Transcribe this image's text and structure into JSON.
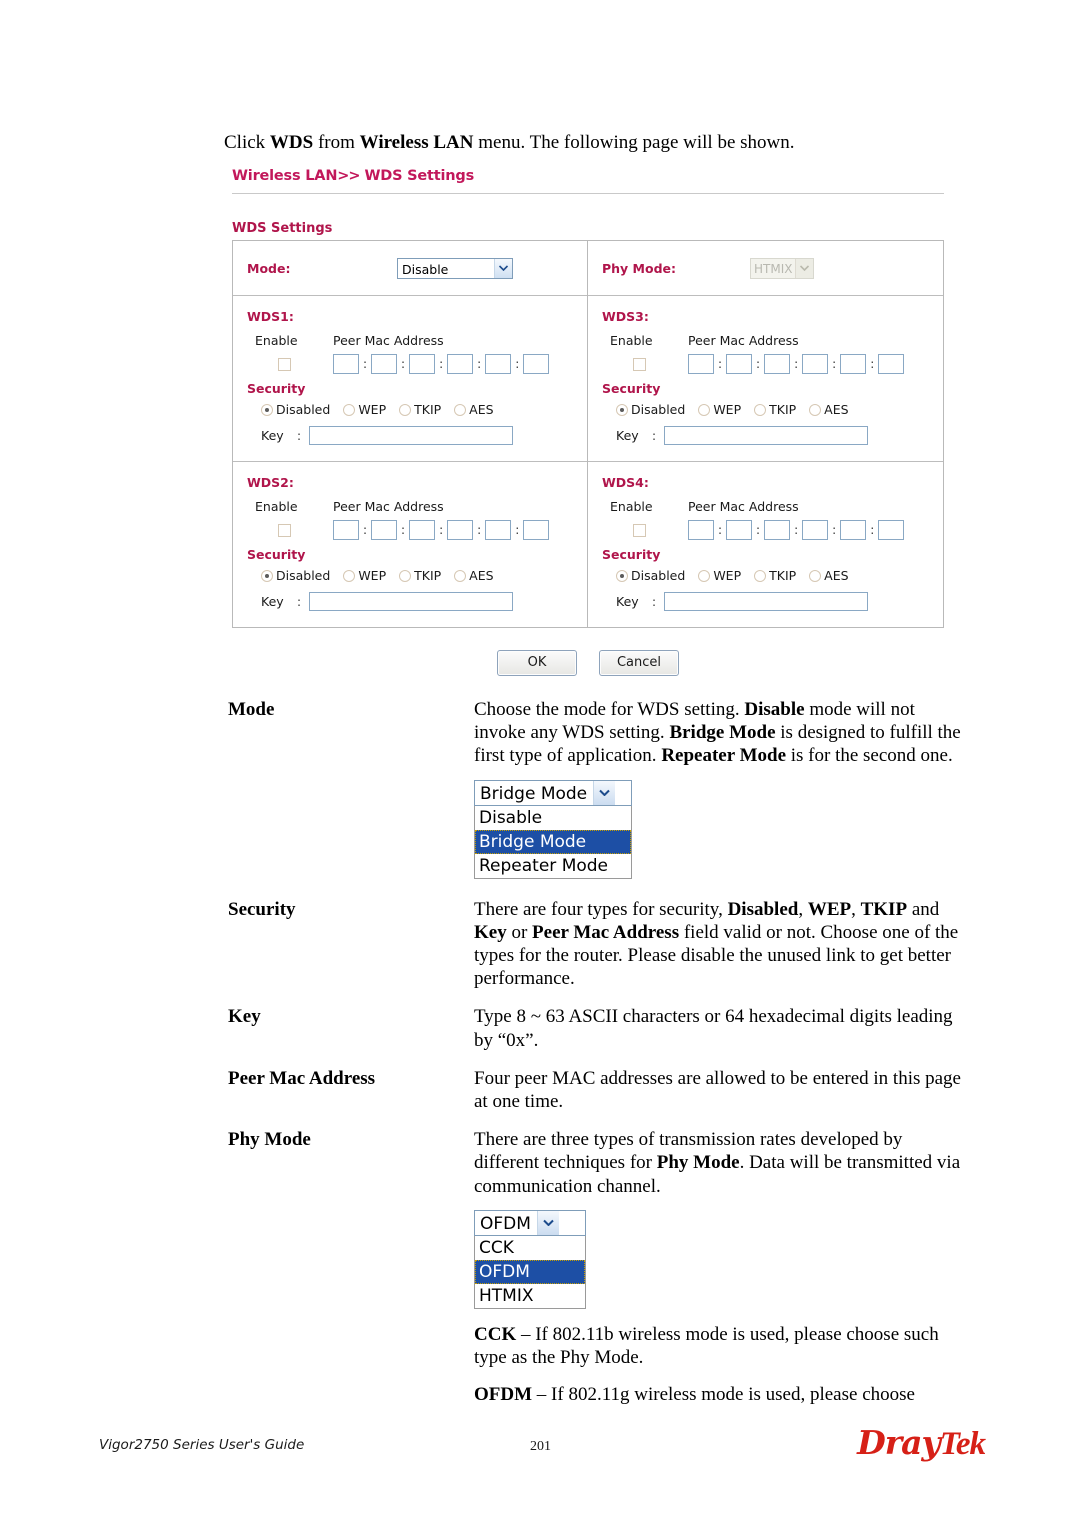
{
  "intro": {
    "pre": "Click ",
    "b1": "WDS",
    "mid1": " from ",
    "b2": "Wireless LAN",
    "post": " menu. The following page will be shown."
  },
  "router_ui": {
    "breadcrumb": {
      "part1": "Wireless LAN",
      "separator": ">>",
      "part2": "WDS Settings"
    },
    "section_title": "WDS Settings",
    "mode": {
      "label": "Mode:",
      "value": "Disable",
      "options": [
        "Disable",
        "Bridge Mode",
        "Repeater Mode"
      ]
    },
    "phy_mode": {
      "label": "Phy Mode:",
      "value": "HTMIX",
      "options": [
        "CCK",
        "OFDM",
        "HTMIX"
      ]
    },
    "column_headers": {
      "enable": "Enable",
      "peer_mac": "Peer Mac Address"
    },
    "security_label": "Security",
    "key_label": "Key",
    "colon": ":",
    "mac_separator": ":",
    "security_options": [
      "Disabled",
      "WEP",
      "TKIP",
      "AES"
    ],
    "security_selected": "Disabled",
    "wds_blocks": [
      {
        "title": "WDS1:",
        "enabled": false,
        "mac": [
          "",
          "",
          "",
          "",
          "",
          ""
        ],
        "key": ""
      },
      {
        "title": "WDS2:",
        "enabled": false,
        "mac": [
          "",
          "",
          "",
          "",
          "",
          ""
        ],
        "key": ""
      },
      {
        "title": "WDS3:",
        "enabled": false,
        "mac": [
          "",
          "",
          "",
          "",
          "",
          ""
        ],
        "key": ""
      },
      {
        "title": "WDS4:",
        "enabled": false,
        "mac": [
          "",
          "",
          "",
          "",
          "",
          ""
        ],
        "key": ""
      }
    ],
    "buttons": {
      "ok": "OK",
      "cancel": "Cancel"
    },
    "colors": {
      "heading": "#c2185b",
      "label": "#b0154b",
      "input_border": "#8aa8c4",
      "select_border": "#7f9db9"
    }
  },
  "definitions": [
    {
      "term": "Mode",
      "desc_html": "Choose the mode for WDS setting. <b>Disable</b> mode will not invoke any WDS setting. <b>Bridge Mode</b> is designed to fulfill the first type of application. <b>Repeater Mode</b> is for the second one."
    },
    {
      "term": "Security",
      "desc_html": "There are four types for security, <b>Disabled</b>, <b>WEP</b>, <b>TKIP</b> and <b>Key</b> or <b>Peer Mac Address</b> field valid or not. Choose one of the types for the router. Please disable the unused link to get better performance."
    },
    {
      "term": "Key",
      "desc_html": "Type 8 ~ 63 ASCII characters or 64 hexadecimal digits leading by “0x”."
    },
    {
      "term": "Peer Mac Address",
      "desc_html": "Four peer MAC addresses are allowed to be entered in this page at one time."
    },
    {
      "term": "Phy Mode",
      "desc_html": "There are three types of transmission rates developed by different techniques for <b>Phy Mode</b>. Data will be transmitted via communication channel."
    }
  ],
  "mode_dropdown": {
    "selected": "Bridge Mode",
    "options": [
      "Disable",
      "Bridge Mode",
      "Repeater Mode"
    ],
    "highlighted": "Bridge Mode"
  },
  "phy_dropdown": {
    "selected": "OFDM",
    "options": [
      "CCK",
      "OFDM",
      "HTMIX"
    ],
    "highlighted": "OFDM"
  },
  "phy_notes": [
    {
      "html": "<b>CCK</b> – If 802.11b wireless mode is used, please choose such type as the Phy Mode."
    },
    {
      "html": "<b>OFDM</b> – If 802.11g wireless mode is used, please choose"
    }
  ],
  "footer": {
    "guide": "Vigor2750 Series User's Guide",
    "page_number": "201",
    "logo_dray": "Dray",
    "logo_tek": "Tek",
    "logo_color": "#d62017"
  }
}
